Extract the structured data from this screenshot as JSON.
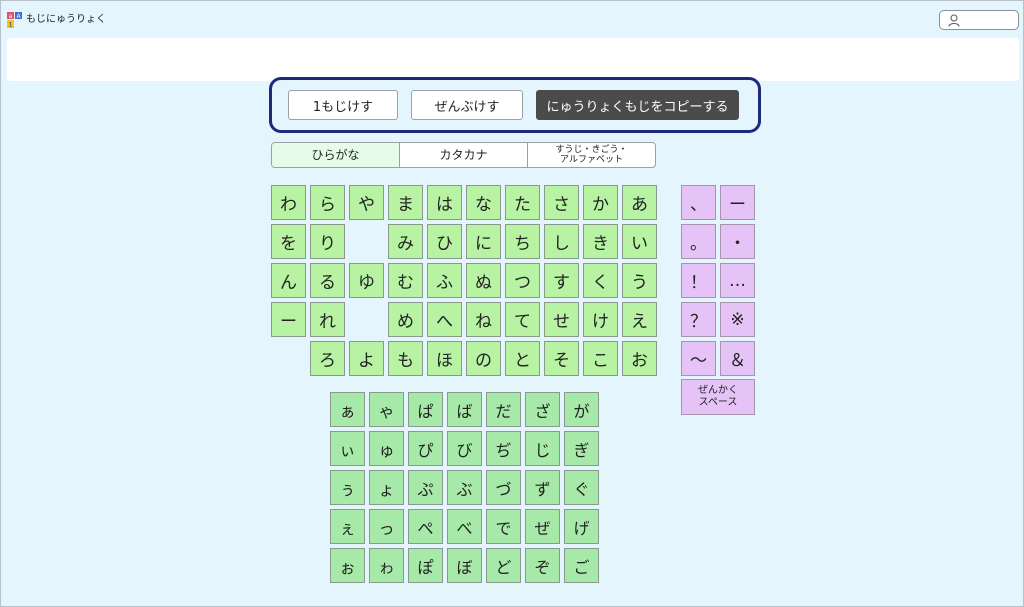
{
  "app": {
    "title": "もじにゅうりょく"
  },
  "actions": {
    "delete_one": "1もじけす",
    "delete_all": "ぜんぶけす",
    "copy": "にゅうりょくもじをコピーする"
  },
  "tabs": [
    {
      "label": "ひらがな"
    },
    {
      "label": "カタカナ"
    },
    {
      "label": "すうじ・きごう・\nアルファベット"
    }
  ],
  "keyboard": {
    "main_rows": [
      [
        "わ",
        "ら",
        "や",
        "ま",
        "は",
        "な",
        "た",
        "さ",
        "か",
        "あ"
      ],
      [
        "を",
        "り",
        "",
        "み",
        "ひ",
        "に",
        "ち",
        "し",
        "き",
        "い"
      ],
      [
        "ん",
        "る",
        "ゆ",
        "む",
        "ふ",
        "ぬ",
        "つ",
        "す",
        "く",
        "う"
      ],
      [
        "ー",
        "れ",
        "",
        "め",
        "へ",
        "ね",
        "て",
        "せ",
        "け",
        "え"
      ],
      [
        "",
        "ろ",
        "よ",
        "も",
        "ほ",
        "の",
        "と",
        "そ",
        "こ",
        "お"
      ]
    ],
    "small_rows": [
      [
        "ぁ",
        "ゃ",
        "ぱ",
        "ば",
        "だ",
        "ざ",
        "が"
      ],
      [
        "ぃ",
        "ゅ",
        "ぴ",
        "び",
        "ぢ",
        "じ",
        "ぎ"
      ],
      [
        "ぅ",
        "ょ",
        "ぷ",
        "ぶ",
        "づ",
        "ず",
        "ぐ"
      ],
      [
        "ぇ",
        "っ",
        "ぺ",
        "べ",
        "で",
        "ぜ",
        "げ"
      ],
      [
        "ぉ",
        "ゎ",
        "ぽ",
        "ぼ",
        "ど",
        "ぞ",
        "ご"
      ]
    ],
    "symbol_rows": [
      [
        "、",
        "ー"
      ],
      [
        "。",
        "・"
      ],
      [
        "！",
        "…"
      ],
      [
        "？",
        "※"
      ],
      [
        "〜",
        "＆"
      ]
    ],
    "space_label": "ぜんかく\nスペース"
  },
  "colors": {
    "background": "#e4f5fd",
    "kana_key": "#b7f3a2",
    "small_kana_key": "#a6e9a8",
    "symbol_key": "#e6c3f6",
    "panel_border": "#1b2a7a",
    "copy_button": "#4b4b4b"
  }
}
